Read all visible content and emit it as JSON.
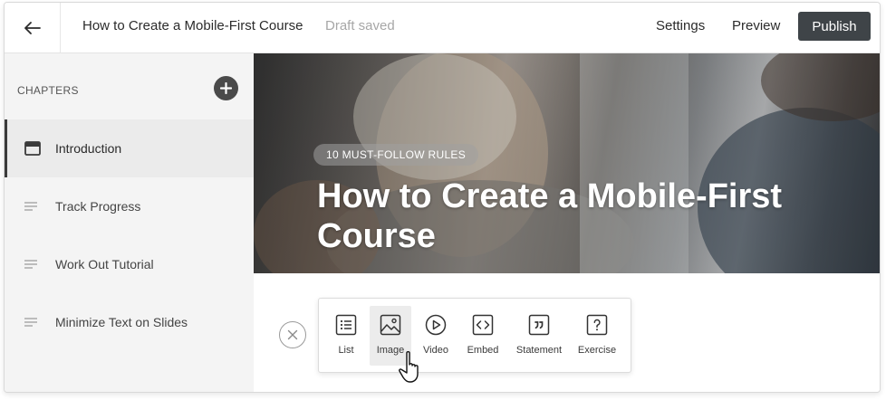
{
  "header": {
    "back_icon": "arrow-left-icon",
    "course_title": "How to Create a Mobile-First Course",
    "status": "Draft saved",
    "settings_label": "Settings",
    "preview_label": "Preview",
    "publish_label": "Publish"
  },
  "sidebar": {
    "heading": "CHAPTERS",
    "add_icon": "plus-circle-icon",
    "chapters": [
      {
        "label": "Introduction",
        "icon": "cover-page-icon",
        "active": true
      },
      {
        "label": "Track Progress",
        "icon": "text-lines-icon",
        "active": false
      },
      {
        "label": "Work Out Tutorial",
        "icon": "text-lines-icon",
        "active": false
      },
      {
        "label": "Minimize Text on Slides",
        "icon": "text-lines-icon",
        "active": false
      }
    ]
  },
  "hero": {
    "badge": "10 MUST-FOLLOW RULES",
    "title": "How to Create a Mobile-First Course"
  },
  "blocks": {
    "close_icon": "close-circle-icon",
    "options": [
      {
        "label": "List",
        "icon": "list-icon"
      },
      {
        "label": "Image",
        "icon": "image-icon"
      },
      {
        "label": "Video",
        "icon": "play-circle-icon"
      },
      {
        "label": "Embed",
        "icon": "code-icon"
      },
      {
        "label": "Statement",
        "icon": "quote-icon"
      },
      {
        "label": "Exercise",
        "icon": "question-icon"
      }
    ]
  },
  "colors": {
    "publish_bg": "#3f4448",
    "sidebar_bg": "#f4f4f4",
    "active_chapter_bg": "#ebebeb"
  }
}
